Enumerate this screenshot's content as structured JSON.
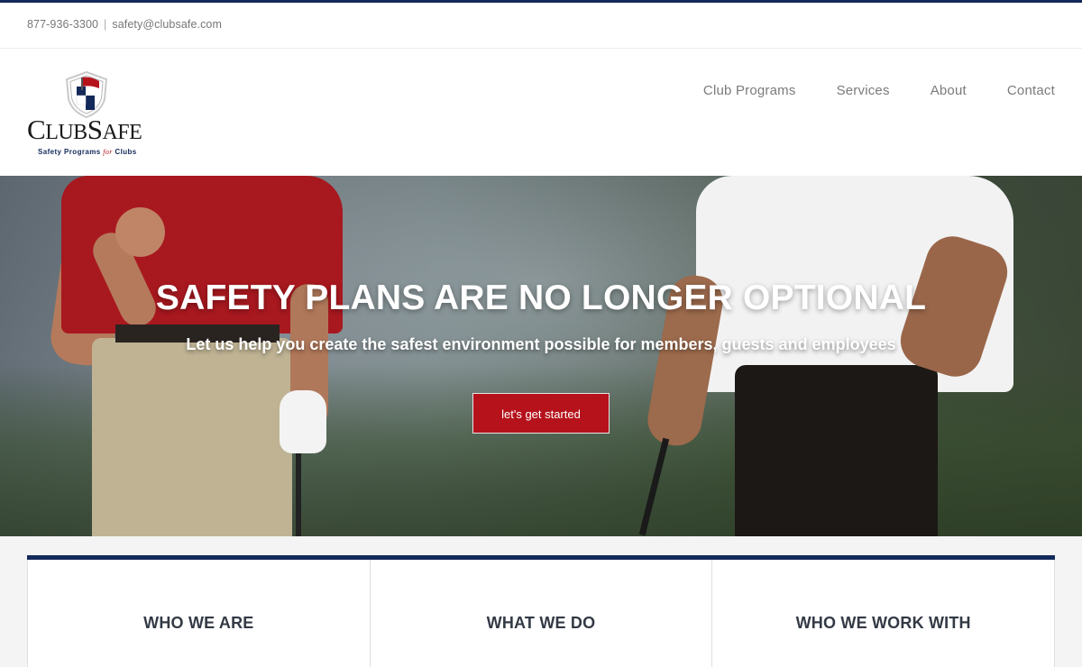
{
  "topbar": {
    "phone": "877-936-3300",
    "separator": "|",
    "email": "safety@clubsafe.com"
  },
  "logo": {
    "wordmark_first": "C",
    "wordmark_rest_1": "LUB",
    "wordmark_s": "S",
    "wordmark_rest_2": "AFE",
    "tagline_pre": "Safety Programs",
    "tagline_for": "for",
    "tagline_post": "Clubs"
  },
  "nav": {
    "items": [
      {
        "label": "Club Programs"
      },
      {
        "label": "Services"
      },
      {
        "label": "About"
      },
      {
        "label": "Contact"
      }
    ]
  },
  "hero": {
    "title": "SAFETY PLANS ARE NO LONGER OPTIONAL",
    "subtitle": "Let us help you create the safest environment possible for members, guests and employees",
    "button_label": "let's get started"
  },
  "cards": [
    {
      "title": "WHO WE ARE"
    },
    {
      "title": "WHAT WE DO"
    },
    {
      "title": "WHO WE WORK WITH"
    }
  ],
  "colors": {
    "navy": "#13295a",
    "red": "#b5121b",
    "nav_text": "#7b7b7b"
  }
}
